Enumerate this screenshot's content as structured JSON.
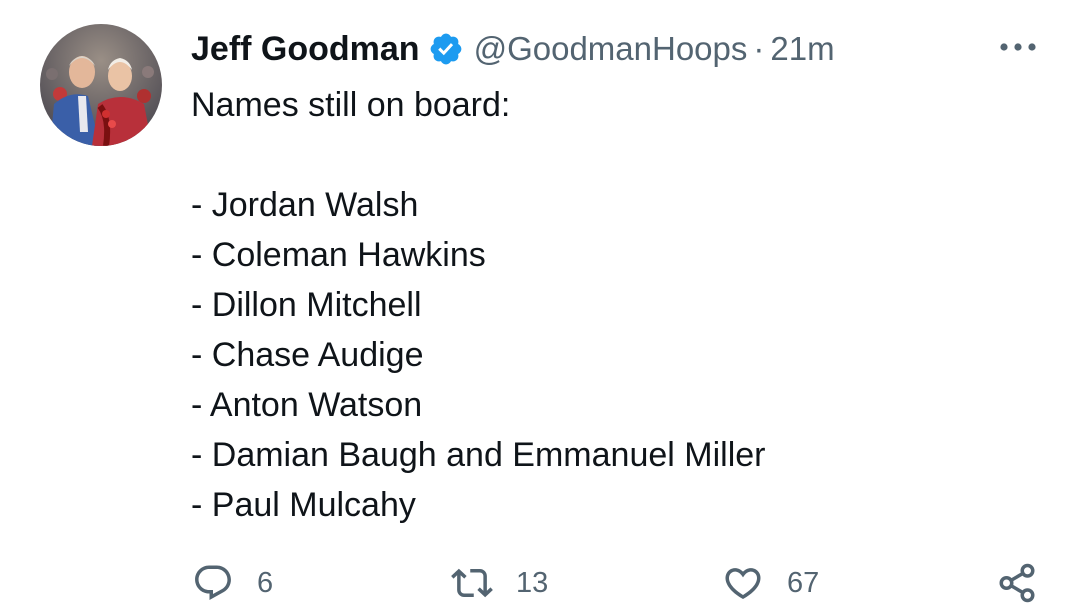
{
  "author": {
    "name": "Jeff Goodman",
    "handle": "@GoodmanHoops",
    "separator": "·",
    "timestamp": "21m",
    "verified_color": "#1d9bf0"
  },
  "tweet": {
    "lines": [
      "Names still on board:",
      "",
      "- Jordan Walsh",
      "- Coleman Hawkins",
      "- Dillon Mitchell",
      "- Chase Audige",
      "- Anton Watson",
      "- Damian Baugh and Emmanuel Miller",
      "- Paul Mulcahy"
    ]
  },
  "actions": {
    "replies": "6",
    "retweets": "13",
    "likes": "67"
  },
  "icons": {
    "more": "more-options-icon",
    "reply": "reply-icon",
    "retweet": "retweet-icon",
    "like": "heart-icon",
    "share": "share-icon",
    "verified": "verified-badge-icon"
  },
  "colors": {
    "text": "#0f1419",
    "secondary": "#536471",
    "accent": "#1d9bf0"
  }
}
